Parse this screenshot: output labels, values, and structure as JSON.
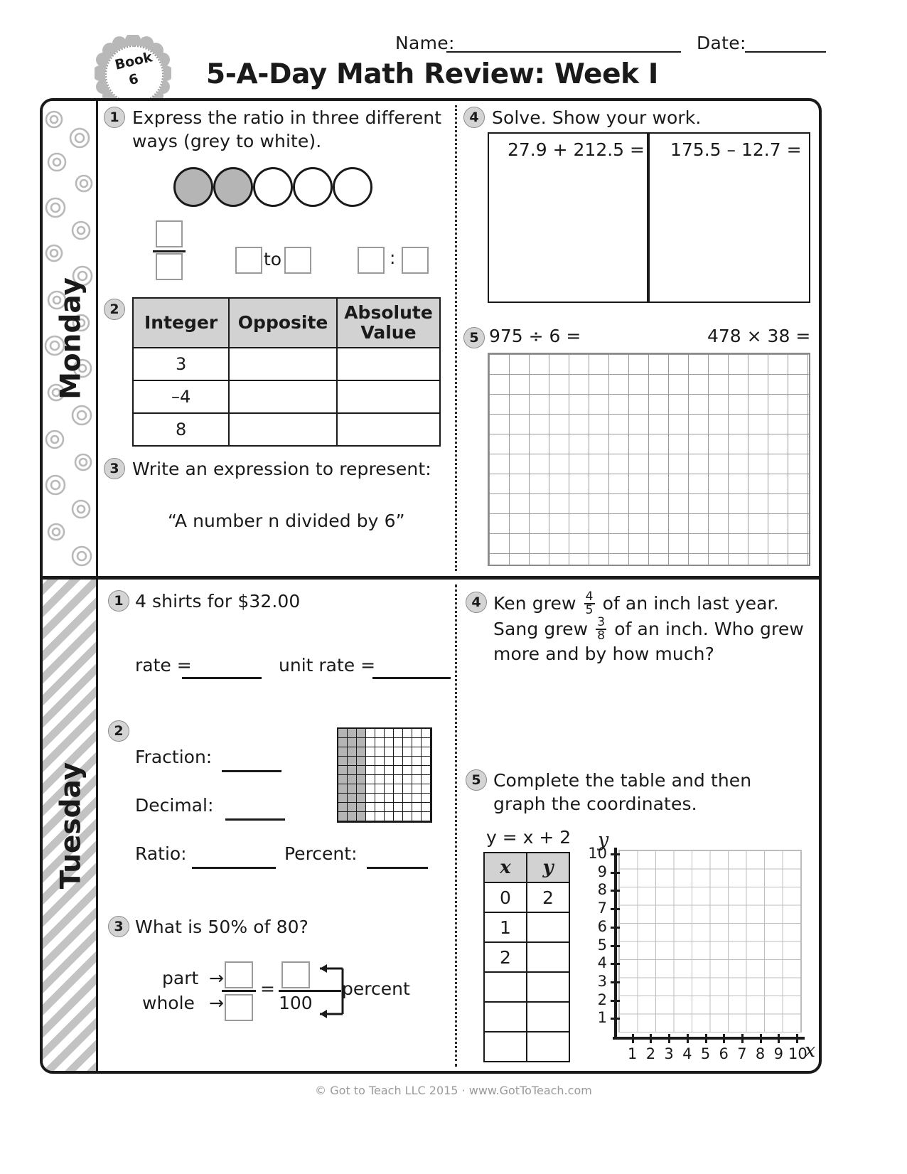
{
  "header": {
    "name_label": "Name:",
    "date_label": "Date:",
    "title": "5-A-Day Math Review: Week I",
    "badge_top": "Book",
    "badge_num": "6"
  },
  "footer": {
    "text": "© Got to Teach LLC 2015 · www.GotToTeach.com"
  },
  "days": [
    {
      "name": "Monday",
      "pattern": "swirls",
      "left": [
        {
          "number": "1",
          "text": "Express the ratio in three different ways (grey to white).",
          "circles": [
            "grey",
            "grey",
            "white",
            "white",
            "white"
          ],
          "answer_forms": {
            "to_label": "to",
            "colon_label": ":"
          }
        },
        {
          "number": "2",
          "table": {
            "headers": [
              "Integer",
              "Opposite",
              "Absolute Value"
            ],
            "rows": [
              [
                "3",
                "",
                ""
              ],
              [
                "–4",
                "",
                ""
              ],
              [
                "8",
                "",
                ""
              ]
            ]
          }
        },
        {
          "number": "3",
          "text": "Write an expression to represent:",
          "quote": "“A number n divided by 6”"
        }
      ],
      "right": [
        {
          "number": "4",
          "text": "Solve. Show your work.",
          "problems": [
            "27.9 + 212.5 =",
            "175.5 – 12.7 ="
          ]
        },
        {
          "number": "5",
          "problems": [
            "975 ÷ 6 =",
            "478 × 38 ="
          ]
        }
      ]
    },
    {
      "name": "Tuesday",
      "pattern": "stripes",
      "left": [
        {
          "number": "1",
          "text": "4 shirts for $32.00",
          "rate_label": "rate =",
          "unit_rate_label": "unit rate ="
        },
        {
          "number": "2",
          "fields": [
            "Fraction:",
            "Decimal:",
            "Ratio:",
            "Percent:"
          ],
          "grid": {
            "columns": 10,
            "rows": 10,
            "shaded_columns": 3
          }
        },
        {
          "number": "3",
          "text": "What is 50% of 80?",
          "part_label": "part",
          "whole_label": "whole",
          "percent_label": "percent",
          "hundred": "100",
          "equals": "="
        }
      ],
      "right": [
        {
          "number": "4",
          "text_parts": [
            "Ken grew ",
            "4",
            "5",
            " of an inch last year. Sang grew ",
            "3",
            "8",
            " of an inch.  Who grew more and by how much?"
          ],
          "text": "Ken grew 4/5 of an inch last year. Sang grew 3/8 of an inch.  Who grew more and by how much?"
        },
        {
          "number": "5",
          "text": "Complete the table and then graph the coordinates.",
          "equation": "y = x + 2",
          "table": {
            "headers": [
              "x",
              "y"
            ],
            "rows": [
              [
                "0",
                "2"
              ],
              [
                "1",
                ""
              ],
              [
                "2",
                ""
              ],
              [
                "",
                ""
              ],
              [
                "",
                ""
              ],
              [
                "",
                ""
              ]
            ]
          },
          "graph": {
            "x_axis_label": "x",
            "y_axis_label": "y",
            "y_ticks": [
              "10",
              "9",
              "8",
              "7",
              "6",
              "5",
              "4",
              "3",
              "2",
              "1"
            ],
            "x_ticks": [
              "1",
              "2",
              "3",
              "4",
              "5",
              "6",
              "7",
              "8",
              "9",
              "10"
            ]
          }
        }
      ]
    }
  ]
}
